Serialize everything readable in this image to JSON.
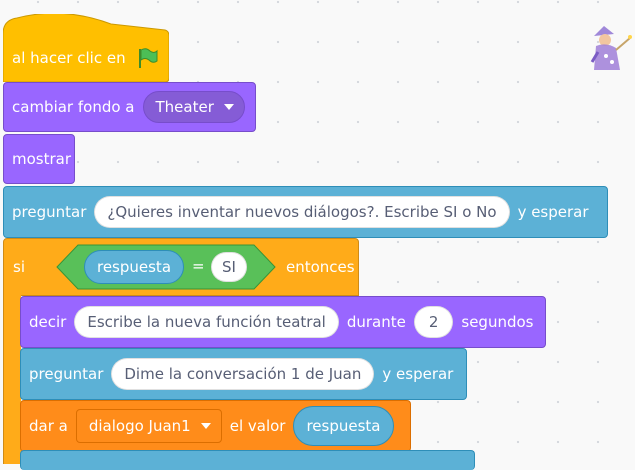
{
  "blocks": {
    "when_flag": {
      "label": "al hacer clic en",
      "icon": "green-flag-icon"
    },
    "switch_backdrop": {
      "label": "cambiar fondo a",
      "value": "Theater"
    },
    "show": {
      "label": "mostrar"
    },
    "ask1": {
      "label": "preguntar",
      "question": "¿Quieres inventar nuevos diálogos?. Escribe SI o No",
      "suffix": "y esperar"
    },
    "if": {
      "label": "si",
      "condition": {
        "left": "respuesta",
        "operator": "=",
        "right": "SI"
      },
      "suffix": "entonces"
    },
    "say": {
      "label": "decir",
      "text": "Escribe la nueva función teatral",
      "mid": "durante",
      "seconds": "2",
      "suffix": "segundos"
    },
    "ask2": {
      "label": "preguntar",
      "question": "Dime la conversación 1 de Juan",
      "suffix": "y esperar"
    },
    "set_var": {
      "label": "dar a",
      "variable": "dialogo Juan1",
      "mid": "el valor",
      "value": "respuesta"
    }
  },
  "colors": {
    "events": "#ffbf00",
    "looks": "#9966ff",
    "sensing": "#5cb1d6",
    "control": "#ffab19",
    "operators": "#59c059",
    "variables": "#ff8c1a"
  },
  "sprite_icon": "wizard-sprite-icon"
}
